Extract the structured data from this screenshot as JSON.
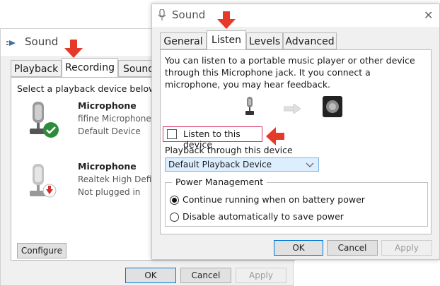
{
  "back_window": {
    "title": "Sound",
    "tabs": [
      "Playback",
      "Recording",
      "Sound"
    ],
    "instruction": "Select a playback device below to",
    "devices": [
      {
        "name": "Microphone",
        "line1": "fifine Microphone",
        "line2": "Default Device",
        "status_icon": "check-badge-icon"
      },
      {
        "name": "Microphone",
        "line1": "Realtek High Defin",
        "line2": "Not plugged in",
        "status_icon": "unplugged-badge-icon"
      }
    ],
    "configure_label": "Configure",
    "ok_label": "OK",
    "cancel_label": "Cancel",
    "apply_label": "Apply"
  },
  "front_dialog": {
    "title": "Sound",
    "close_glyph": "✕",
    "tabs": [
      "General",
      "Listen",
      "Levels",
      "Advanced"
    ],
    "active_tab": "Listen",
    "description": "You can listen to a portable music player or other device through this Microphone jack. It you connect a microphone, you may hear feedback.",
    "listen_label": "Listen to this device",
    "listen_checked": false,
    "playback_label": "Playback through this device",
    "playback_selected": "Default Playback Device",
    "power_group_title": "Power Management",
    "power_options": [
      {
        "label": "Continue running when on battery power",
        "selected": true
      },
      {
        "label": "Disable automatically to save power",
        "selected": false
      }
    ],
    "ok_label": "OK",
    "cancel_label": "Cancel",
    "apply_label": "Apply"
  },
  "colors": {
    "arrow": "#e53a2a",
    "highlight_border": "#d6315e",
    "select_bg": "#ddeeff",
    "check_green": "#2e8b3a"
  }
}
